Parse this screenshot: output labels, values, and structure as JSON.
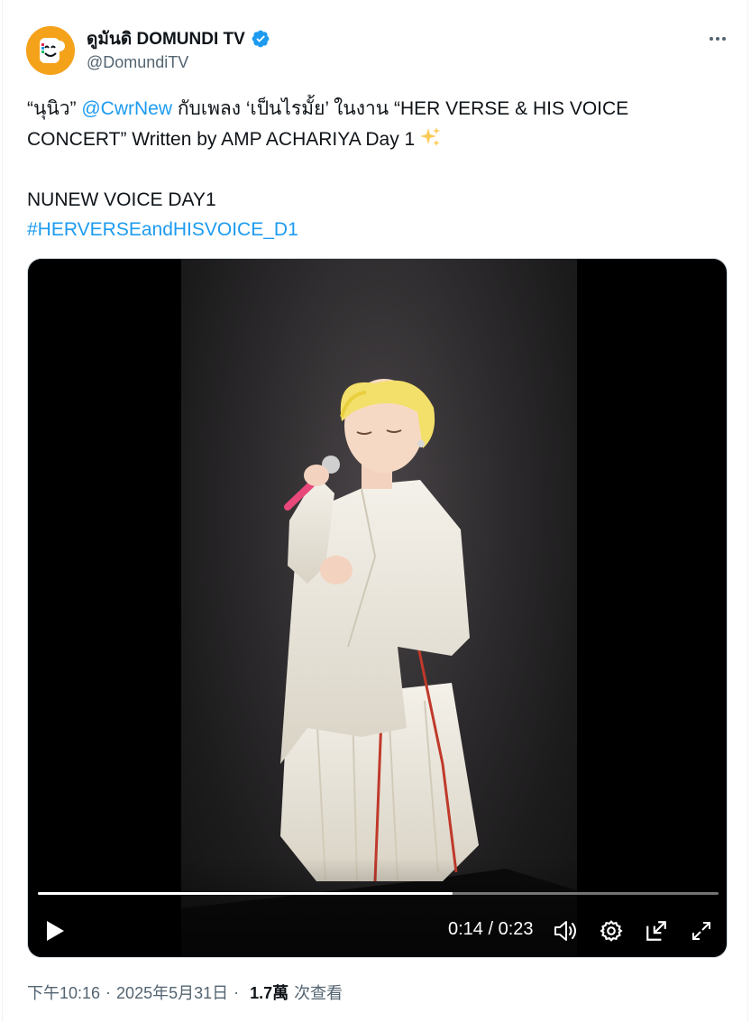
{
  "account": {
    "display_name": "ดูมันดิ DOMUNDI TV",
    "handle": "@DomundiTV",
    "verified": true,
    "avatar_icon": "domundi-logo-icon",
    "avatar_color": "#f5a21b"
  },
  "tweet": {
    "line1_prefix": "“นุนิว”",
    "mention": "@CwrNew",
    "line1_suffix": "กับเพลง ‘เป็นไรมั้ย’ ในงาน “HER VERSE & HIS VOICE",
    "line2": "CONCERT” Written by AMP ACHARIYA Day 1",
    "line2_emoji": "sparkles-icon",
    "line4": "NUNEW VOICE DAY1",
    "hashtag": "#HERVERSEandHISVOICE_D1"
  },
  "video": {
    "current_time": "0:14",
    "separator": "/",
    "duration": "0:23",
    "progress_fraction": 0.609,
    "icons": {
      "play": "play-icon",
      "volume": "volume-icon",
      "settings": "gear-icon",
      "pip": "picture-in-picture-icon",
      "fullscreen": "fullscreen-icon"
    }
  },
  "meta": {
    "time": "下午10:16",
    "date": "2025年5月31日",
    "dot": "·",
    "views_count": "1.7萬",
    "views_label": "次查看"
  },
  "colors": {
    "link": "#1d9bf0",
    "verified": "#1d9bf0",
    "secondary_text": "#536471",
    "primary_text": "#0f1419"
  }
}
